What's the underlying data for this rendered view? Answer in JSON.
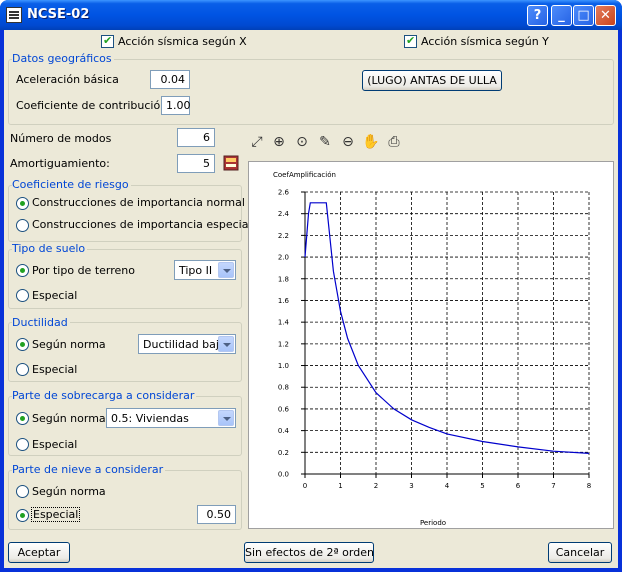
{
  "window": {
    "title": "NCSE-02"
  },
  "checks": {
    "accion_x": "Acción sísmica según X",
    "accion_y": "Acción sísmica según Y"
  },
  "geo": {
    "title": "Datos geográficos",
    "aceleracion_label": "Aceleración básica",
    "aceleracion_value": "0.04",
    "coef_label": "Coeficiente de contribución",
    "coef_value": "1.00",
    "location_button": "(LUGO) ANTAS DE ULLA"
  },
  "modos": {
    "label": "Número de modos",
    "value": "6"
  },
  "amort": {
    "label": "Amortiguamiento:",
    "value": "5"
  },
  "riesgo": {
    "title": "Coeficiente de riesgo",
    "opt1": "Construcciones de importancia normal",
    "opt2": "Construcciones de importancia especial"
  },
  "suelo": {
    "title": "Tipo de suelo",
    "opt1": "Por tipo de terreno",
    "select": "Tipo II",
    "opt2": "Especial"
  },
  "ductilidad": {
    "title": "Ductilidad",
    "opt1": "Según norma",
    "select": "Ductilidad baja",
    "opt2": "Especial"
  },
  "sobrecarga": {
    "title": "Parte de sobrecarga a considerar",
    "opt1": "Según norma",
    "select": "0.5: Viviendas",
    "opt2": "Especial"
  },
  "nieve": {
    "title": "Parte de nieve a considerar",
    "opt1": "Según norma",
    "opt2": "Especial",
    "value": "0.50"
  },
  "buttons": {
    "aceptar": "Aceptar",
    "sin_efectos": "Sin efectos de 2ª orden",
    "cancelar": "Cancelar"
  },
  "toolbar": [
    "zoom-extents-icon",
    "zoom-window-icon",
    "zoom-2x-icon",
    "measure-icon",
    "zoom-out-icon",
    "pan-hand-icon",
    "print-icon"
  ],
  "chart_data": {
    "type": "line",
    "title": "",
    "ylabel": "CoefAmplificación",
    "xlabel": "Periodo",
    "xlim": [
      0,
      8
    ],
    "ylim": [
      0,
      2.6
    ],
    "xticks": [
      0,
      1,
      2,
      3,
      4,
      5,
      6,
      7,
      8
    ],
    "yticks": [
      0,
      0.2,
      0.4,
      0.6,
      0.8,
      1.0,
      1.2,
      1.4,
      1.6,
      1.8,
      2.0,
      2.2,
      2.4,
      2.6
    ],
    "ytick_labels": [
      "0.0",
      "0.2",
      "0.4",
      "0.6",
      "0.8",
      "1.0",
      "1.2",
      "1.4",
      "1.6",
      "1.8",
      "2.0",
      "2.2",
      "2.4",
      "2.6"
    ],
    "grid": true,
    "line_color": "#0000cc",
    "series": [
      {
        "x": [
          0,
          0.1,
          0.15,
          0.6,
          0.8,
          1.0,
          1.2,
          1.5,
          2.0,
          2.5,
          3.0,
          3.5,
          4.0,
          5.0,
          6.0,
          7.0,
          8.0
        ],
        "y": [
          2.0,
          2.4,
          2.5,
          2.5,
          1.87,
          1.5,
          1.25,
          1.0,
          0.75,
          0.6,
          0.5,
          0.43,
          0.37,
          0.3,
          0.25,
          0.21,
          0.19
        ]
      }
    ]
  }
}
